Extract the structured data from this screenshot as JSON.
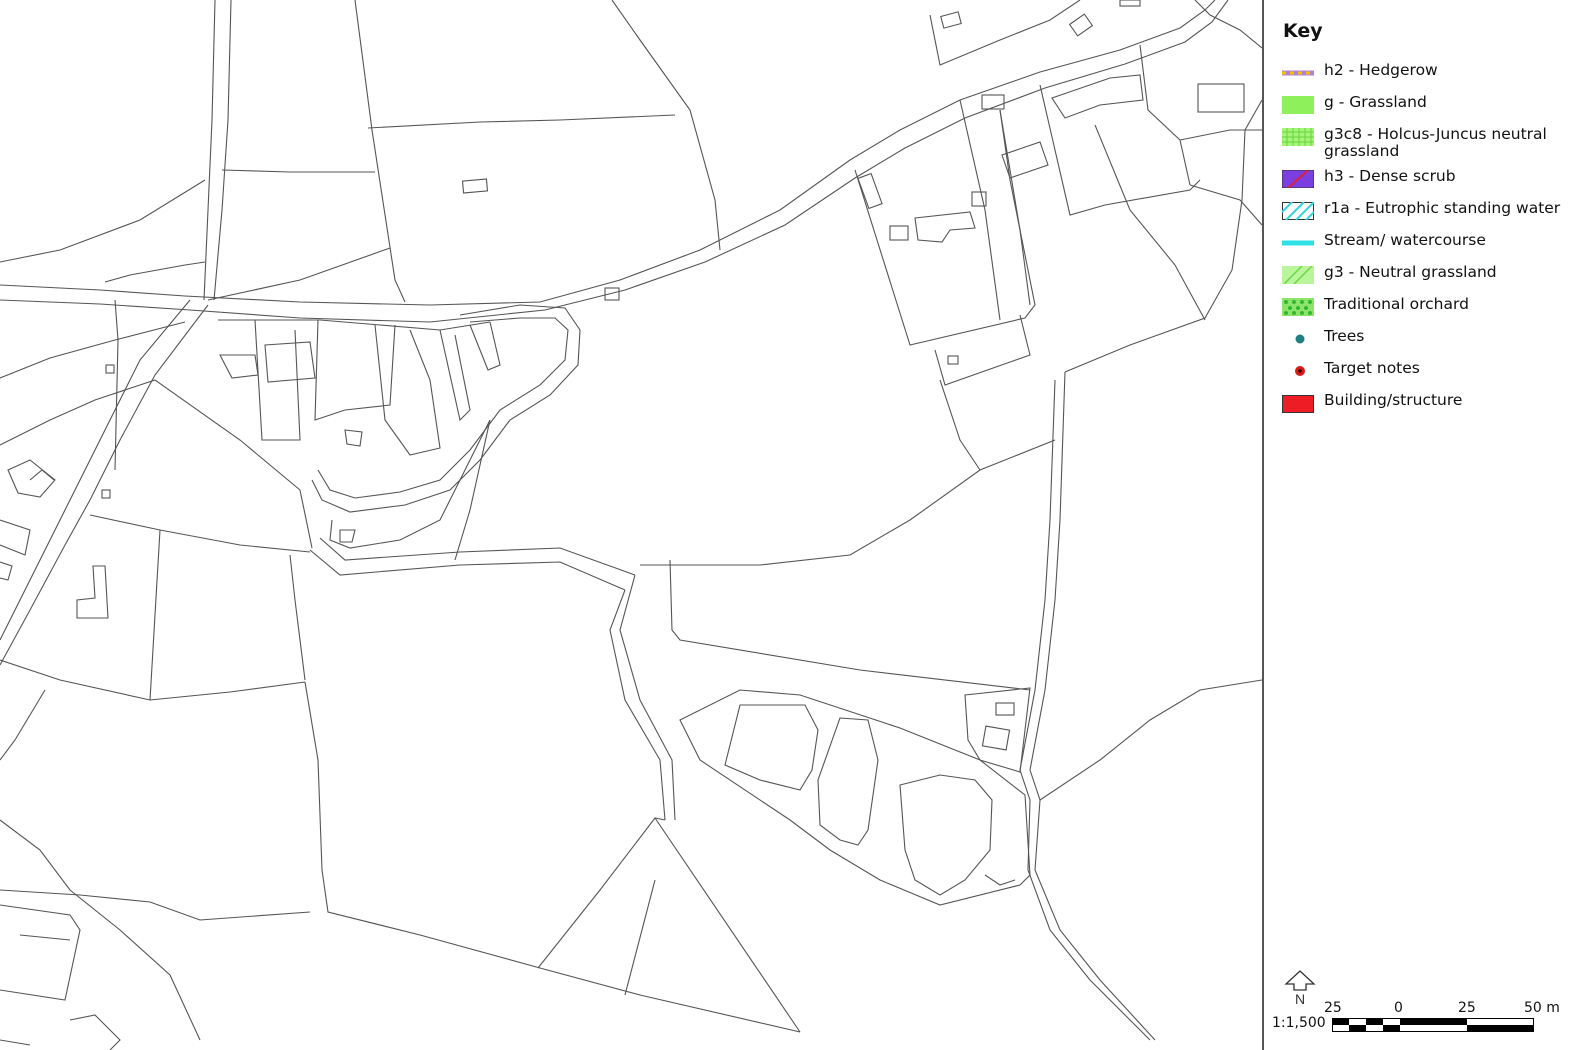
{
  "legend": {
    "title": "Key",
    "items": [
      {
        "label": "h2 - Hedgerow",
        "icon": "hedgerow-swatch",
        "colors": [
          "#b27fd6",
          "#f2c100"
        ]
      },
      {
        "label": "g - Grassland",
        "icon": "grassland-swatch",
        "colors": [
          "#8ef05a"
        ]
      },
      {
        "label": "g3c8 - Holcus-Juncus neutral grassland",
        "icon": "holcus-juncus-swatch",
        "colors": [
          "#a4f57a",
          "#6cd43e"
        ]
      },
      {
        "label": "h3 - Dense scrub",
        "icon": "dense-scrub-swatch",
        "colors": [
          "#7b3fe0",
          "#e0203a"
        ]
      },
      {
        "label": "r1a - Eutrophic standing water",
        "icon": "standing-water-swatch",
        "colors": [
          "#ffffff",
          "#2fd6dc"
        ]
      },
      {
        "label": "Stream/ watercourse",
        "icon": "stream-line",
        "colors": [
          "#2fe0e6"
        ]
      },
      {
        "label": "g3 - Neutral grassland",
        "icon": "neutral-grassland-swatch",
        "colors": [
          "#b9f59a",
          "#6ed64a"
        ]
      },
      {
        "label": "Traditional orchard",
        "icon": "orchard-swatch",
        "colors": [
          "#2fb82f",
          "#8be36a"
        ]
      },
      {
        "label": "Trees",
        "icon": "tree-dot",
        "colors": [
          "#1f7f83"
        ]
      },
      {
        "label": "Target notes",
        "icon": "target-note-dot",
        "colors": [
          "#d81a1a",
          "#3a0000"
        ]
      },
      {
        "label": "Building/structure",
        "icon": "building-swatch",
        "colors": [
          "#ee1c24"
        ]
      }
    ]
  },
  "north_arrow": {
    "label": "N"
  },
  "scale": {
    "ratio": "1:1,500",
    "ticks": [
      "25",
      "0",
      "25",
      "50 m"
    ]
  },
  "map": {
    "line_color": "#555555"
  }
}
